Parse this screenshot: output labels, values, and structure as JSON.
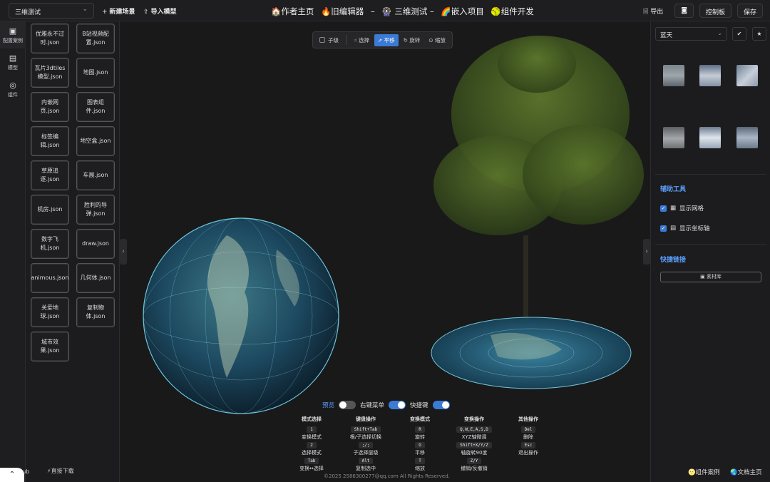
{
  "topbar": {
    "scene_select": "三维测试",
    "new_scene": "新建场景",
    "import_model": "导入模型",
    "nav": [
      "🏠作者主页",
      "🔥旧编辑器",
      "–",
      "🎡 三维测试 –",
      "🌈嵌入项目",
      "🥎组件开发"
    ],
    "export": "导出",
    "control_panel": "控制板",
    "save": "保存"
  },
  "leftnav": [
    {
      "label": "配置案例",
      "icon": "config-icon"
    },
    {
      "label": "模型",
      "icon": "model-icon"
    },
    {
      "label": "组件",
      "icon": "component-icon"
    }
  ],
  "files": [
    "优雅永不过时.json",
    "B站视频配置.json",
    "瓦片3dtiles模型.json",
    "地图.json",
    "内嵌网页.json",
    "图表组件.json",
    "标签编辑.json",
    "地空盒.json",
    "草原追逐.json",
    "车展.json",
    "机房.json",
    "胜利的导弹.json",
    "数字飞机.json",
    "draw.json",
    "animous.json",
    "几何体.json",
    "关爱地球.json",
    "复制物体.json",
    "城市效果.json"
  ],
  "bottom_left": {
    "github": "GitHub",
    "download": "⚡直接下载"
  },
  "viewport_toolbar": {
    "child": "子级",
    "tools": [
      "选择",
      "平移",
      "旋转",
      "缩放"
    ],
    "active": "平移"
  },
  "toggles": {
    "preview": "预览",
    "context_menu": "右键菜单",
    "shortcuts": "快捷键"
  },
  "shortcut_table": [
    {
      "title": "模式选择",
      "rows": [
        [
          "1",
          "变换模式"
        ],
        [
          "2",
          "选择模式"
        ],
        [
          "Tab",
          "变换↔选择"
        ]
      ]
    },
    {
      "title": "键盘操作",
      "rows": [
        [
          "Shift+Tab",
          "根/子选择切换"
        ],
        [
          ";/;",
          "子选择层级"
        ],
        [
          "Alt",
          "复制选中"
        ]
      ]
    },
    {
      "title": "变换模式",
      "rows": [
        [
          "R",
          "旋转"
        ],
        [
          "G",
          "平移"
        ],
        [
          "T",
          "缩放"
        ]
      ]
    },
    {
      "title": "变换操作",
      "rows": [
        [
          "Q,W,E,A,S,D",
          "XYZ轴微调"
        ],
        [
          "Shift+X/Y/Z",
          "轴旋转90度"
        ],
        [
          "Z/Y",
          "撤销/反撤销"
        ]
      ]
    },
    {
      "title": "其他操作",
      "rows": [
        [
          "Del",
          "删除"
        ],
        [
          "Esc",
          "退出操作"
        ],
        [
          "",
          ""
        ]
      ]
    }
  ],
  "copyright": "©2025 2586300277@qq.com All Rights Reserved.",
  "rightpanel": {
    "sky_select": "蓝天",
    "tools_title": "辅助工具",
    "show_grid": "显示网格",
    "show_axes": "显示坐标轴",
    "links_title": "快捷链接",
    "material_lib": "素材库",
    "component_cases": "🌝组件案例",
    "docs_home": "🌏文档主页"
  },
  "colors": {
    "accent": "#3b7bd6",
    "link": "#5aa0ff"
  }
}
